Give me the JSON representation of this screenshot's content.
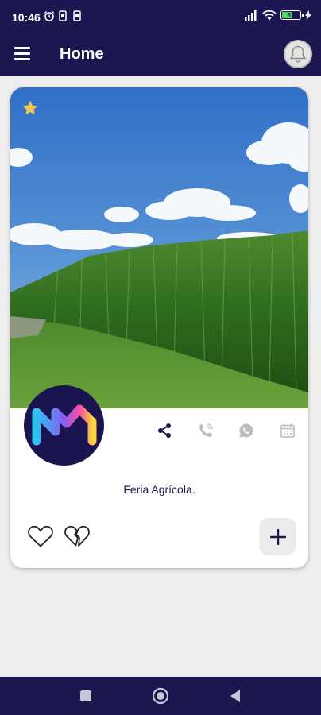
{
  "status_bar": {
    "time": "10:46",
    "battery": "61",
    "battery_level": 0.61
  },
  "app_bar": {
    "title": "Home"
  },
  "card": {
    "title": "Feria Agrícola.",
    "favorite": true
  },
  "colors": {
    "primary": "#1c1750",
    "star": "#f2c94c",
    "battery": "#4cd964",
    "muted_icon": "#bdbdbd"
  },
  "icons": {
    "menu": "menu-icon",
    "notifications": "bell-icon",
    "favorite": "star-icon",
    "share": "share-icon",
    "call": "phone-icon",
    "whatsapp": "whatsapp-icon",
    "calendar": "calendar-icon",
    "like": "heart-icon",
    "dislike": "broken-heart-icon",
    "add": "plus-icon"
  }
}
